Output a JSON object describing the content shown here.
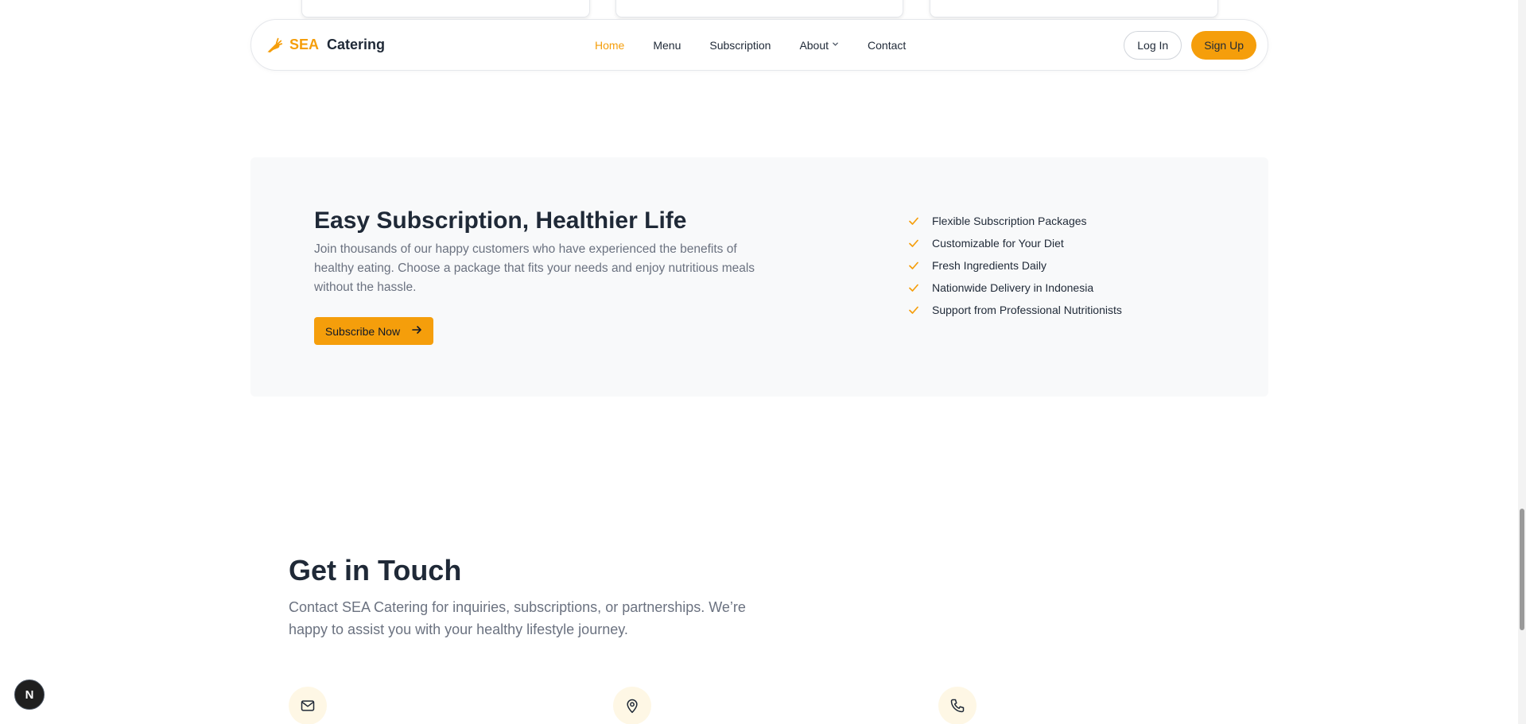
{
  "header": {
    "brand_sea": "SEA",
    "brand_catering": "Catering",
    "nav": [
      {
        "label": "Home",
        "active": true
      },
      {
        "label": "Menu"
      },
      {
        "label": "Subscription"
      },
      {
        "label": "About"
      },
      {
        "label": "Contact"
      }
    ],
    "login_label": "Log In",
    "signup_label": "Sign Up"
  },
  "subscription": {
    "title": "Easy Subscription, Healthier Life",
    "description": "Join thousands of our happy customers who have experienced the benefits of healthy eating. Choose a package that fits your needs and enjoy nutritious meals without the hassle.",
    "button_label": "Subscribe Now",
    "features": [
      "Flexible Subscription Packages",
      "Customizable for Your Diet",
      "Fresh Ingredients Daily",
      "Nationwide Delivery in Indonesia",
      "Support from Professional Nutritionists"
    ]
  },
  "contact": {
    "title": "Get in Touch",
    "description": "Contact SEA Catering for inquiries, subscriptions, or partnerships. We’re happy to assist you with your healthy lifestyle journey.",
    "icons": [
      "mail-icon",
      "map-pin-icon",
      "phone-icon"
    ]
  },
  "dev_badge": "N",
  "colors": {
    "accent": "#f59e0b",
    "text": "#1f2937",
    "muted": "#6b7280",
    "panel_bg": "#f8f9fa",
    "icon_bg": "#fef7e5"
  }
}
